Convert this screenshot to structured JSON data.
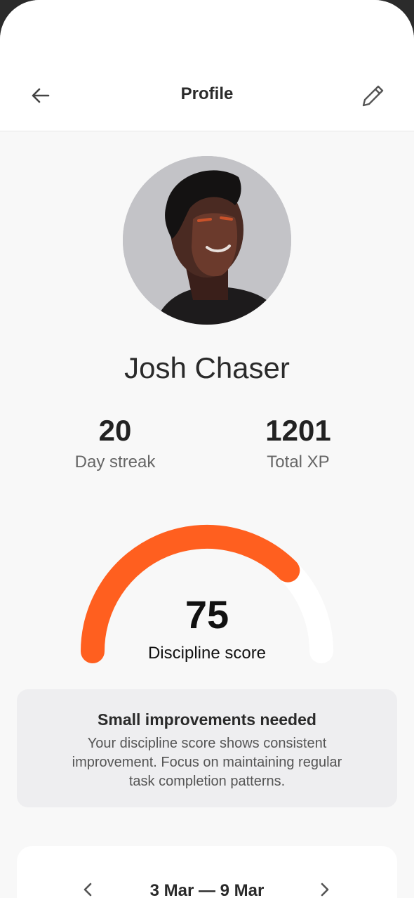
{
  "header": {
    "title": "Profile",
    "back_icon": "arrow-left-icon",
    "edit_icon": "pencil-icon"
  },
  "profile": {
    "name": "Josh Chaser"
  },
  "stats": [
    {
      "value": "20",
      "label": "Day streak"
    },
    {
      "value": "1201",
      "label": "Total XP"
    }
  ],
  "discipline": {
    "score": "75",
    "label": "Discipline score",
    "fraction": 0.75,
    "accent": "#ff5f1f"
  },
  "info_card": {
    "title": "Small improvements needed",
    "body": "Your discipline score shows consistent improvement. Focus on maintaining regular task completion patterns."
  },
  "week": {
    "range": "3 Mar — 9 Mar",
    "prev_icon": "chevron-left-icon",
    "next_icon": "chevron-right-icon"
  }
}
